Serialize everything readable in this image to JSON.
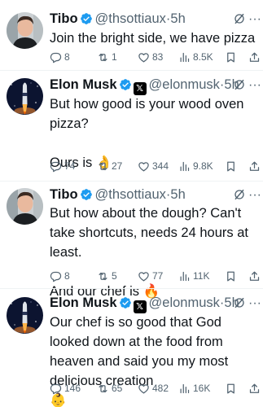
{
  "tweets": [
    {
      "name": "Tibo",
      "handle": "@thsottiaux",
      "sep": "·",
      "time": "5h",
      "text": "Join the bright side, we have pizza",
      "replies": "8",
      "reposts": "1",
      "likes": "83",
      "views": "8.5K",
      "verified": true,
      "x_badge": false
    },
    {
      "name": "Elon Musk",
      "handle": "@elonmusk",
      "sep": "·",
      "time": "5h",
      "text": "But how good is your wood oven pizza?\n\nOurs is 👌",
      "replies": "74",
      "reposts": "27",
      "likes": "344",
      "views": "9.8K",
      "verified": true,
      "x_badge": true
    },
    {
      "name": "Tibo",
      "handle": "@thsottiaux",
      "sep": "·",
      "time": "5h",
      "text": "But how about the dough? Can't take shortcuts, needs 24 hours at least.\n\nAnd our chef is 🔥",
      "replies": "8",
      "reposts": "5",
      "likes": "77",
      "views": "11K",
      "verified": true,
      "x_badge": false
    },
    {
      "name": "Elon Musk",
      "handle": "@elonmusk",
      "sep": "·",
      "time": "5h",
      "text": "Our chef is so good that God looked down at the food from heaven and said you my most delicious creation\n👶",
      "replies": "146",
      "reposts": "65",
      "likes": "482",
      "views": "16K",
      "verified": true,
      "x_badge": true
    }
  ],
  "icons": {
    "reply": "reply-icon",
    "repost": "repost-icon",
    "like": "like-icon",
    "views": "views-icon",
    "bookmark": "bookmark-icon",
    "share": "share-icon",
    "grok": "grok-icon",
    "more": "more-icon",
    "verified": "verified-badge-icon",
    "x": "x-affiliation-badge-icon"
  },
  "colors": {
    "text": "#0f1419",
    "secondary": "#536471",
    "verified": "#1d9bf0",
    "divider": "#eff3f4"
  }
}
